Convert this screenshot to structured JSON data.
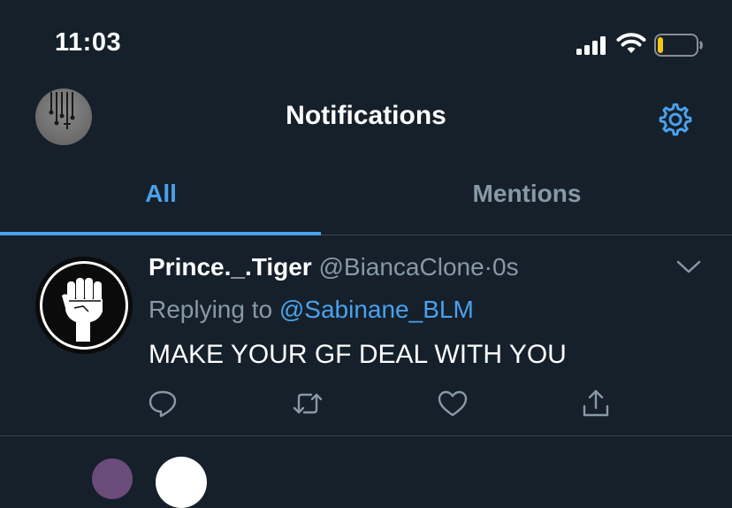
{
  "status_bar": {
    "time": "11:03",
    "battery_level": 0.15,
    "battery_color": "#f5c518"
  },
  "header": {
    "title": "Notifications"
  },
  "tabs": [
    {
      "label": "All",
      "active": true
    },
    {
      "label": "Mentions",
      "active": false
    }
  ],
  "tweet": {
    "name": "Prince._.Tiger",
    "handle": "@BiancaClone",
    "separator": "·",
    "age": "0s",
    "replying_prefix": "Replying to",
    "replying_to": "@Sabinane_BLM",
    "text": "MAKE YOUR GF DEAL WITH YOU"
  },
  "colors": {
    "background": "#15202b",
    "accent": "#4aa1eb",
    "muted": "#8899a6",
    "divider": "#38444d"
  },
  "icons": [
    "avatar",
    "gear-icon",
    "chevron-down-icon",
    "reply-icon",
    "retweet-icon",
    "like-icon",
    "share-icon"
  ]
}
